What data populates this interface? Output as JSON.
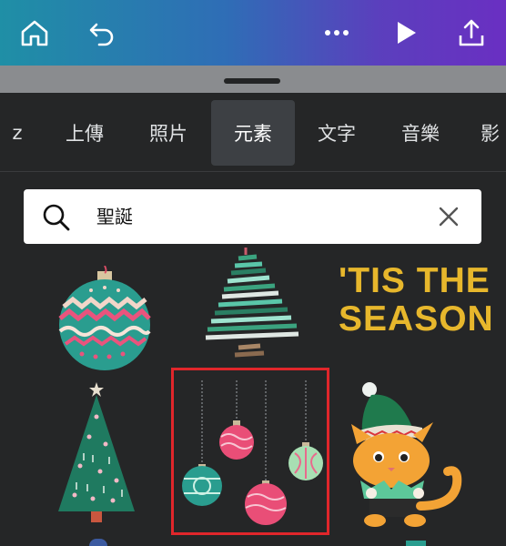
{
  "toolbar": {
    "home_icon": "home-icon",
    "undo_icon": "undo-icon",
    "more_icon": "more-icon",
    "play_icon": "play-icon",
    "share_icon": "share-icon"
  },
  "tabs": [
    {
      "label": "z",
      "active": false
    },
    {
      "label": "上傳",
      "active": false
    },
    {
      "label": "照片",
      "active": false
    },
    {
      "label": "元素",
      "active": true
    },
    {
      "label": "文字",
      "active": false
    },
    {
      "label": "音樂",
      "active": false
    },
    {
      "label": "影",
      "active": false
    }
  ],
  "search": {
    "value": "聖誕"
  },
  "results": {
    "season_text_line1": "'TIS THE",
    "season_text_line2": "SEASON",
    "items": [
      {
        "name": "ornament-ball",
        "selected": false
      },
      {
        "name": "ribbon-christmas-tree",
        "selected": false
      },
      {
        "name": "tis-the-season-text",
        "selected": false
      },
      {
        "name": "christmas-tree",
        "selected": false
      },
      {
        "name": "hanging-ornaments",
        "selected": true
      },
      {
        "name": "elf-cat",
        "selected": false
      }
    ]
  },
  "colors": {
    "selection": "#e0262b",
    "season_text": "#e7b72c"
  }
}
